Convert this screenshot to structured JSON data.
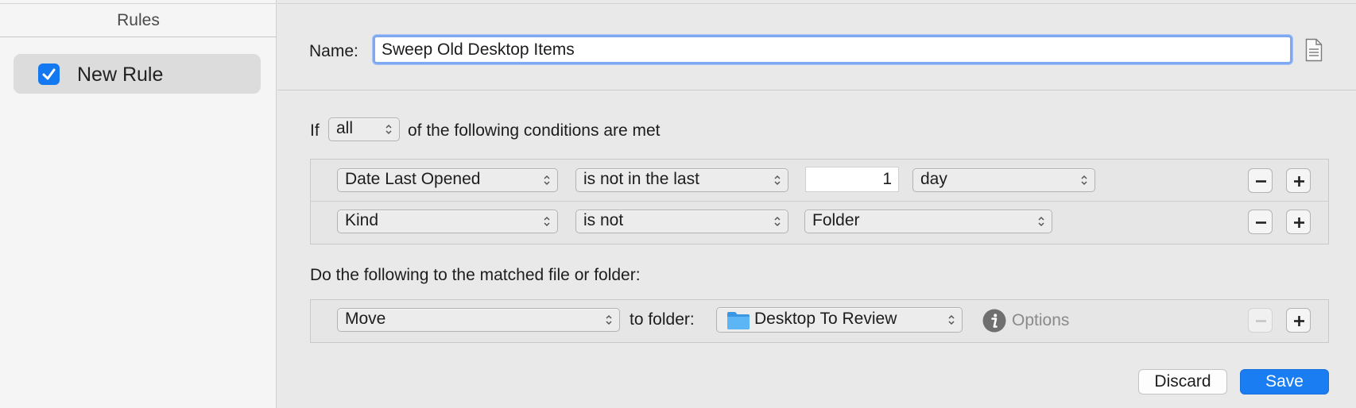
{
  "sidebar": {
    "header": "Rules",
    "rules": [
      {
        "label": "New Rule",
        "enabled": true
      }
    ]
  },
  "editor": {
    "name_label": "Name:",
    "name_value": "Sweep Old Desktop Items",
    "doc_icon": "document-icon"
  },
  "conditions": {
    "if_label": "If",
    "match_mode": "all",
    "suffix_label": "of the following conditions are met",
    "rows": [
      {
        "attribute": "Date Last Opened",
        "operator": "is not in the last",
        "value": "1",
        "unit": "day"
      },
      {
        "attribute": "Kind",
        "operator": "is not",
        "value": "Folder"
      }
    ]
  },
  "actions": {
    "label": "Do the following to the matched file or folder:",
    "rows": [
      {
        "action": "Move",
        "to_folder_label": "to folder:",
        "folder": "Desktop To Review",
        "options_label": "Options",
        "minus_enabled": false
      }
    ]
  },
  "buttons": {
    "discard": "Discard",
    "save": "Save"
  },
  "colors": {
    "accent": "#1a7ef2",
    "checkbox": "#1479f0",
    "folder": "#4aa8f0"
  }
}
